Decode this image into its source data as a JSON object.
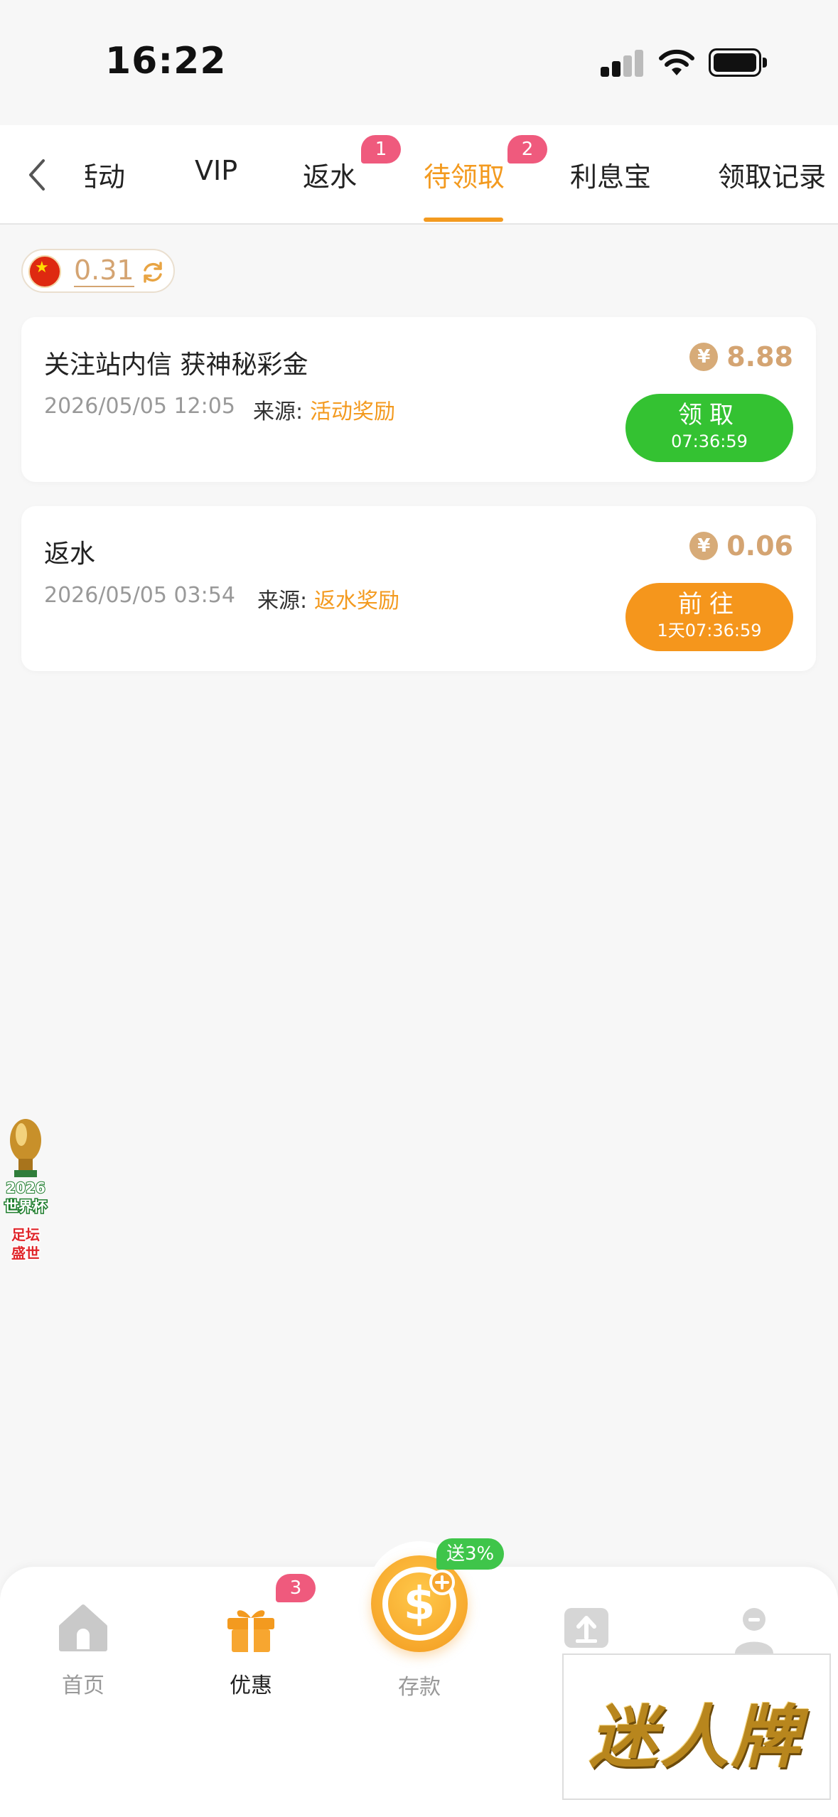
{
  "status_bar": {
    "time": "16:22"
  },
  "tabs": [
    {
      "label": "活动",
      "active": false
    },
    {
      "label": "VIP",
      "active": false
    },
    {
      "label": "返水",
      "active": false,
      "badge": "1"
    },
    {
      "label": "待领取",
      "active": true,
      "badge": "2"
    },
    {
      "label": "利息宝",
      "active": false
    },
    {
      "label": "领取记录",
      "active": false
    }
  ],
  "balance": {
    "value": "0.31"
  },
  "rewards": [
    {
      "title": "关注站内信 获神秘彩金",
      "date": "2026/05/05 12:05",
      "source_label": "来源:",
      "source": "活动奖励",
      "amount": "8.88",
      "currency_symbol": "¥",
      "button_label": "领取",
      "button_countdown": "07:36:59",
      "button_color": "#34c232"
    },
    {
      "title": "返水",
      "date": "2026/05/05 03:54",
      "source_label": "来源:",
      "source": "返水奖励",
      "amount": "0.06",
      "currency_symbol": "¥",
      "button_label": "前往",
      "button_countdown": "1天07:36:59",
      "button_color": "#f5961c"
    }
  ],
  "floating_badge": {
    "line1": "2026",
    "line2": "世界杯",
    "line3": "足坛",
    "line4": "盛世"
  },
  "bottom_nav": {
    "home": "首页",
    "promo": "优惠",
    "promo_badge": "3",
    "deposit": "存款",
    "deposit_promo": "送3%"
  },
  "watermark": {
    "text": "迷人牌"
  },
  "colors": {
    "accent": "#f39a1f",
    "gold": "#d4a472",
    "badge": "#ef5a7d",
    "green": "#34c232"
  }
}
